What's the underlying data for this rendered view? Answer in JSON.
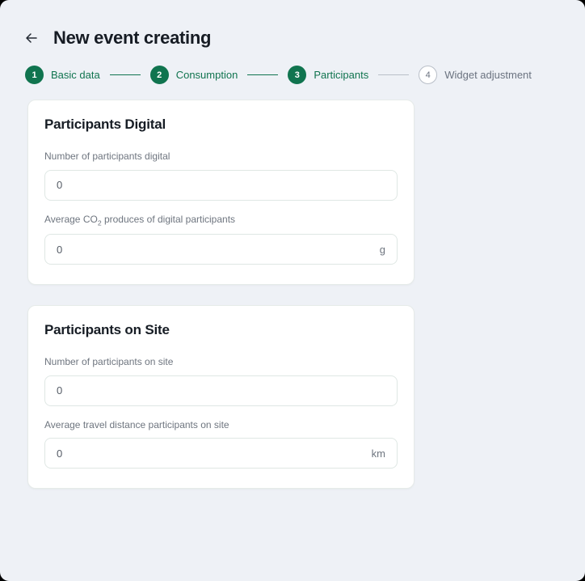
{
  "header": {
    "back_icon": "arrow-left-icon",
    "title": "New event creating"
  },
  "stepper": {
    "steps": [
      {
        "number": "1",
        "label": "Basic data",
        "state": "done"
      },
      {
        "number": "2",
        "label": "Consumption",
        "state": "done"
      },
      {
        "number": "3",
        "label": "Participants",
        "state": "done"
      },
      {
        "number": "4",
        "label": "Widget adjustment",
        "state": "todo"
      }
    ]
  },
  "colors": {
    "accent_green": "#10744f",
    "muted_gray": "#6b7380",
    "page_background": "#eef1f6",
    "card_background": "#ffffff",
    "input_border": "#dfe7e4"
  },
  "cards": [
    {
      "title": "Participants Digital",
      "fields": [
        {
          "label": "Number of participants digital",
          "value": "",
          "placeholder": "0",
          "suffix": ""
        },
        {
          "label_prefix": "Average CO",
          "label_sub": "2",
          "label_suffix": " produces of digital participants",
          "value": "",
          "placeholder": "0",
          "suffix": "g"
        }
      ]
    },
    {
      "title": "Participants on Site",
      "fields": [
        {
          "label": "Number of participants on site",
          "value": "",
          "placeholder": "0",
          "suffix": ""
        },
        {
          "label": "Average travel distance participants on site",
          "value": "",
          "placeholder": "0",
          "suffix": "km"
        }
      ]
    }
  ]
}
